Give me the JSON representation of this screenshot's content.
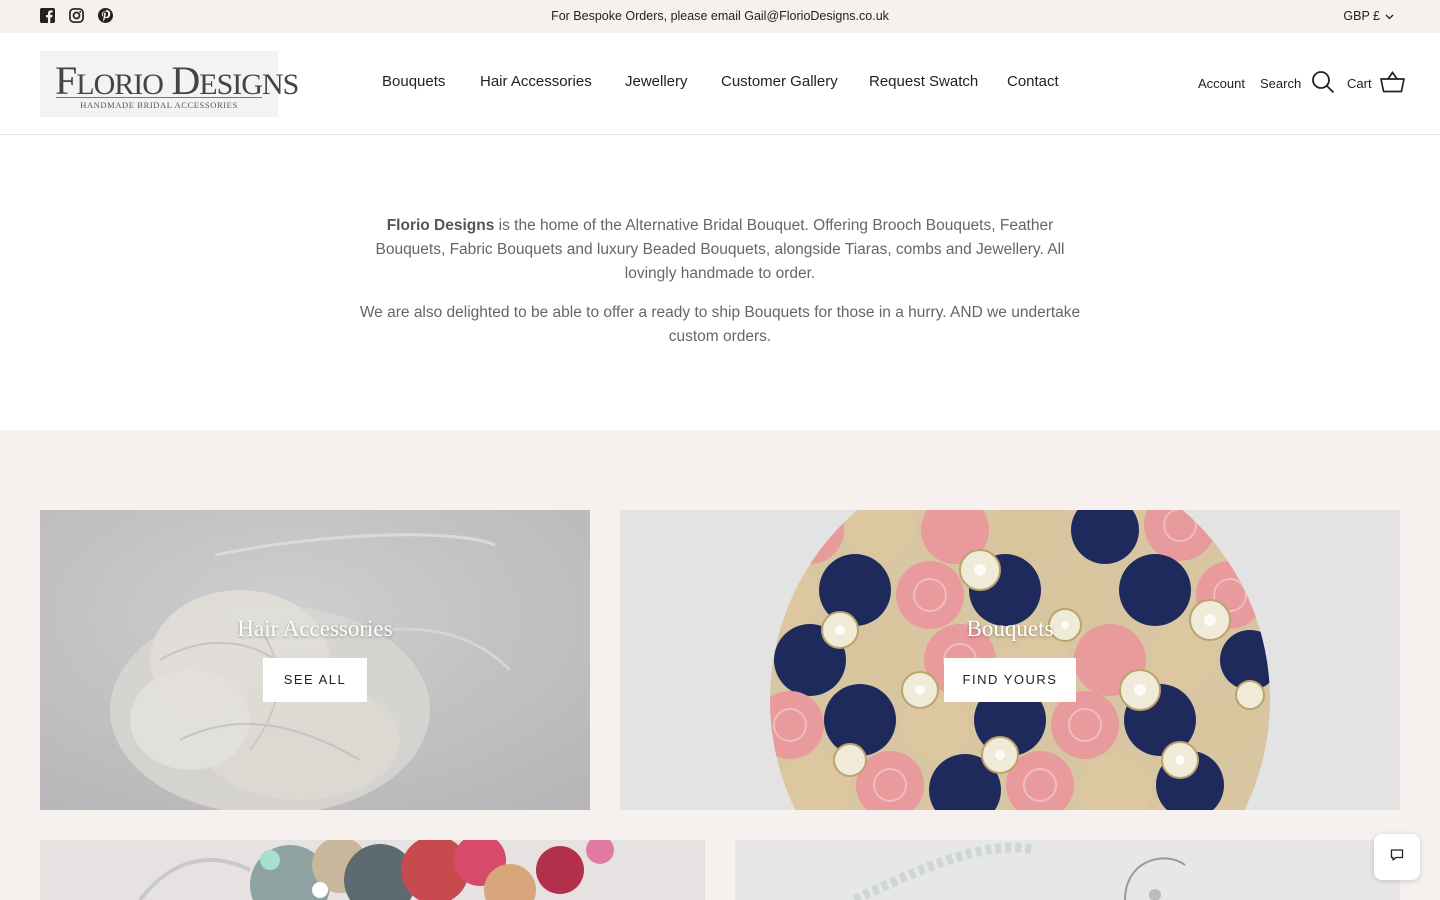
{
  "topbar": {
    "announcement": "For Bespoke Orders, please email Gail@FlorioDesigns.co.uk",
    "currency": "GBP £",
    "social_icons": [
      "facebook-icon",
      "instagram-icon",
      "pinterest-icon"
    ]
  },
  "header": {
    "logo_main": "FLORIO DESIGNS",
    "logo_sub": "HANDMADE BRIDAL ACCESSORIES",
    "nav": [
      "Bouquets",
      "Hair Accessories",
      "Jewellery",
      "Customer Gallery",
      "Request Swatch",
      "Contact"
    ],
    "account": "Account",
    "search": "Search",
    "cart": "Cart"
  },
  "intro": {
    "brand": "Florio Designs",
    "p1_rest": " is the home of the Alternative Bridal Bouquet. Offering Brooch Bouquets, Feather Bouquets, Fabric Bouquets and luxury Beaded Bouquets, alongside Tiaras, combs and Jewellery. All lovingly handmade to order.",
    "p2": "We are also delighted to be able to offer a ready to ship Bouquets for those in a hurry. AND we undertake custom orders."
  },
  "collections": [
    {
      "title": "Hair Accessories",
      "button": "SEE ALL"
    },
    {
      "title": "Bouquets",
      "button": "FIND YOURS"
    }
  ],
  "colors": {
    "announcement_bg": "#f6f0ee",
    "section_bg": "#f6f1ef",
    "navy": "#1f2a5c",
    "pink": "#e99a9a",
    "champagne": "#dcc9a4"
  }
}
